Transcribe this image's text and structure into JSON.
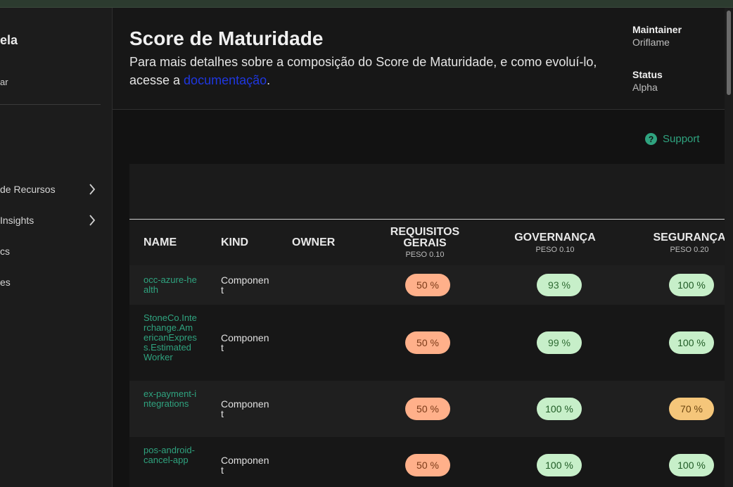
{
  "sidebar": {
    "title": "ela",
    "subtitle": "ar",
    "items": [
      {
        "label": "de Recursos",
        "chevron": true
      },
      {
        "label": "Insights",
        "chevron": true
      },
      {
        "label": "cs",
        "chevron": false
      },
      {
        "label": "es",
        "chevron": false
      }
    ]
  },
  "header": {
    "title": "Score de Maturidade",
    "description_pre": "Para mais detalhes sobre a composição do Score de Maturidade, e como evoluí-lo, acesse a ",
    "link_text": "documentação",
    "description_post": ".",
    "maintainer_label": "Maintainer",
    "maintainer_value": "Oriflame",
    "status_label": "Status",
    "status_value": "Alpha"
  },
  "support": {
    "label": "Support",
    "icon": "help-circle-icon"
  },
  "table": {
    "columns": [
      {
        "label": "NAME"
      },
      {
        "label": "KIND"
      },
      {
        "label": "OWNER"
      },
      {
        "label": "REQUISITOS GERAIS",
        "weight": "PESO 0.10"
      },
      {
        "label": "GOVERNANÇA",
        "weight": "PESO 0.10"
      },
      {
        "label": "SEGURANÇA",
        "weight": "PESO 0.20"
      }
    ],
    "rows": [
      {
        "name": "occ-azure-health",
        "kind": "Component",
        "owner": "",
        "scores": [
          "50 %",
          "93 %",
          "100 %"
        ]
      },
      {
        "name": "StoneCo.Interchange.AmericanExpress.EstimatedWorker",
        "kind": "Component",
        "owner": "",
        "scores": [
          "50 %",
          "99 %",
          "100 %"
        ]
      },
      {
        "name": "ex-payment-integrations",
        "kind": "Component",
        "owner": "",
        "scores": [
          "50 %",
          "100 %",
          "70 %"
        ]
      },
      {
        "name": "pos-android-cancel-app",
        "kind": "Component",
        "owner": "",
        "scores": [
          "50 %",
          "100 %",
          "100 %"
        ]
      }
    ]
  },
  "colors": {
    "accent": "#2fa37f",
    "pill_orange": "#ffb08a",
    "pill_green": "#c7efc9",
    "pill_yellow": "#f5c67a"
  }
}
